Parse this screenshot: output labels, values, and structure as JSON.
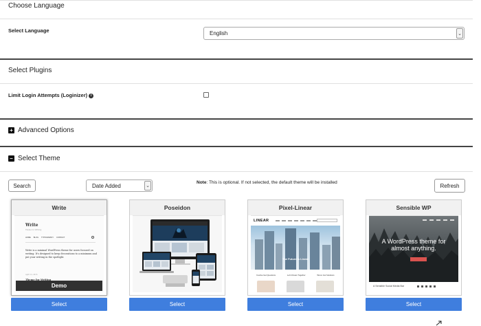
{
  "language_section": {
    "title": "Choose Language",
    "field_label": "Select Language",
    "selected": "English"
  },
  "plugins_section": {
    "title": "Select Plugins",
    "field_label": "Limit Login Attempts (Loginizer)",
    "info_icon": "info-icon",
    "checked": false
  },
  "advanced_section": {
    "title": "Advanced Options",
    "icon": "plus-square-icon"
  },
  "theme_section": {
    "title": "Select Theme",
    "icon": "minus-square-icon",
    "search_label": "Search",
    "sort_selected": "Date Added",
    "note_label": "Note",
    "note_text": ": This is optional. If not selected, the default theme will be installed",
    "refresh_label": "Refresh",
    "select_label": "Select",
    "demo_label": "Demo",
    "select_color": "#3f7ede",
    "themes": [
      {
        "name": "Write",
        "preview": {
          "site_title": "Write",
          "tagline": "Theme for Writing",
          "nav": [
            "HOME",
            "BLOG",
            "TYPOGRAPHY",
            "CONTACT"
          ],
          "body": "Write is a minimal WordPress theme for users focused on writing. It's designed to keep decorations to a minimum and put your writing in the spotlight.",
          "date": "April 12, 2016",
          "post_title": "Theme for Writing"
        }
      },
      {
        "name": "Poseidon"
      },
      {
        "name": "Pixel-Linear",
        "preview": {
          "logo": "LINEAR",
          "hero": "The Future Is Linear",
          "features": [
            "Festive Get Questions",
            "Let's Dream Together",
            "We've Got Solutions"
          ]
        }
      },
      {
        "name": "Sensible WP",
        "preview": {
          "headline": "A WordPress theme for almost anything.",
          "footer": "A Sensible Social Media Bar"
        }
      }
    ]
  }
}
